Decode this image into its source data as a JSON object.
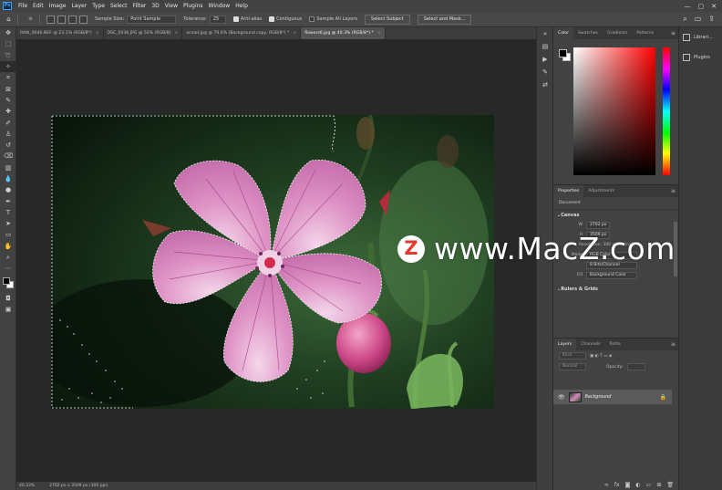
{
  "app": {
    "logo": "Ps",
    "menu": [
      "File",
      "Edit",
      "Image",
      "Layer",
      "Type",
      "Select",
      "Filter",
      "3D",
      "View",
      "Plugins",
      "Window",
      "Help"
    ],
    "window_controls": [
      "—",
      "▢",
      "✕"
    ]
  },
  "options": {
    "sample_size_label": "Sample Size:",
    "sample_size_value": "Point Sample",
    "tolerance_label": "Tolerance:",
    "tolerance_value": "25",
    "anti_alias": "Anti-alias",
    "contiguous": "Contiguous",
    "sample_all_layers": "Sample All Layers",
    "select_subject": "Select Subject",
    "select_and_mask": "Select and Mask..."
  },
  "tabs": [
    {
      "label": "RAW_9046.NEF @ 23.1% (RGB/8*)",
      "active": false
    },
    {
      "label": "DSC_0036.JPG @ 50% (RGB/8)",
      "active": false
    },
    {
      "label": "ocelot.jpg @ 79.6% (Background copy, RGB/8*) *",
      "active": false
    },
    {
      "label": "flowers6.jpg @ 40.3% (RGB/8*) *",
      "active": true
    }
  ],
  "status": {
    "zoom": "40.33%",
    "doc_info": "2702 px x 3509 px (300 ppi)"
  },
  "color_panel": {
    "tabs": [
      "Color",
      "Swatches",
      "Gradients",
      "Patterns"
    ]
  },
  "properties": {
    "tabs": [
      "Properties",
      "Adjustments"
    ],
    "document_label": "Document",
    "canvas_section": "Canvas",
    "w_label": "W",
    "w_value": "2702 px",
    "h_label": "H",
    "h_value": "3509 px",
    "resolution": "Resolution: 300 pixels/inch",
    "mode_label": "Mode",
    "mode_value": "RGB Color",
    "depth_value": "8 Bits/Channel",
    "fill_label": "Fill",
    "fill_value": "Background Color",
    "rulers_section": "Rulers & Grids"
  },
  "layers": {
    "tabs": [
      "Layers",
      "Channels",
      "Paths"
    ],
    "kind_placeholder": "Kind",
    "blend_mode": "Normal",
    "opacity_label": "Opacity:",
    "layer_name": "Background"
  },
  "side_panel": {
    "items": [
      "Librari...",
      "Plugins"
    ]
  },
  "watermark": {
    "logo_letter": "Z",
    "text": "www.MacZ.com"
  }
}
